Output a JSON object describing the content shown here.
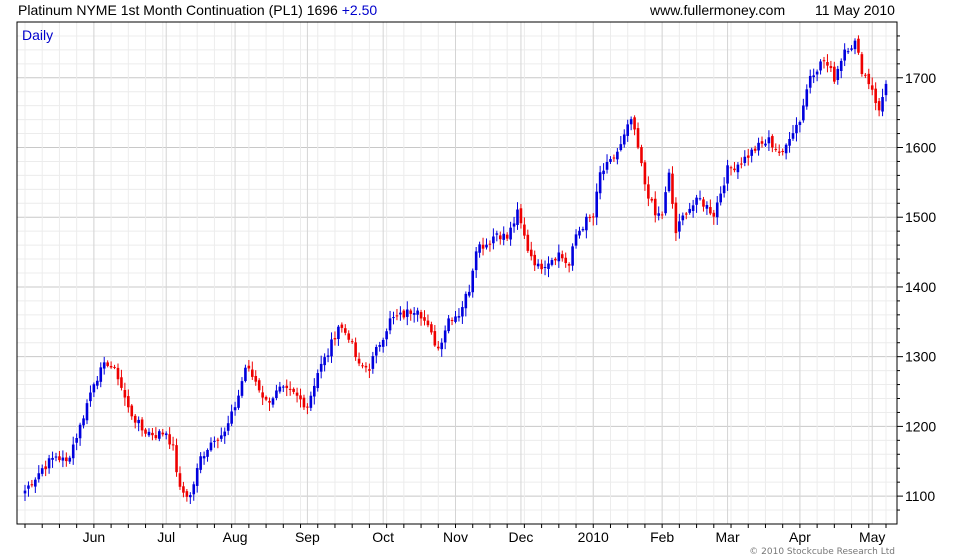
{
  "header": {
    "title": "Platinum NYME 1st Month Continuation (PL1)",
    "last_price": "1696",
    "change": "+2.50",
    "site": "www.fullermoney.com",
    "date": "11 May 2010"
  },
  "footer": {
    "copyright": "© 2010 Stockcube Research Ltd"
  },
  "colors": {
    "up": "#0000dd",
    "down": "#ee0000",
    "grid": "#dcdcdc",
    "frame": "#000000",
    "label_blue": "#0000cc"
  },
  "chart_data": {
    "type": "candlestick",
    "period_label": "Daily",
    "ylim": [
      1060,
      1780
    ],
    "y_ticks": [
      1100,
      1200,
      1300,
      1400,
      1500,
      1600,
      1700
    ],
    "x_ticks": [
      "Jun",
      "Jul",
      "Aug",
      "Sep",
      "Oct",
      "Nov",
      "Dec",
      "2010",
      "Feb",
      "Mar",
      "Apr",
      "May"
    ],
    "x_tick_index": [
      20,
      41,
      61,
      82,
      104,
      125,
      144,
      165,
      185,
      204,
      225,
      246
    ],
    "grid": true,
    "close_points": [
      [
        0,
        1108
      ],
      [
        5,
        1140
      ],
      [
        9,
        1158
      ],
      [
        12,
        1148
      ],
      [
        16,
        1200
      ],
      [
        20,
        1265
      ],
      [
        24,
        1292
      ],
      [
        27,
        1272
      ],
      [
        30,
        1225
      ],
      [
        34,
        1195
      ],
      [
        38,
        1188
      ],
      [
        41,
        1192
      ],
      [
        43,
        1168
      ],
      [
        45,
        1108
      ],
      [
        48,
        1100
      ],
      [
        51,
        1155
      ],
      [
        55,
        1185
      ],
      [
        58,
        1190
      ],
      [
        60,
        1215
      ],
      [
        62,
        1245
      ],
      [
        64,
        1285
      ],
      [
        67,
        1265
      ],
      [
        70,
        1235
      ],
      [
        74,
        1252
      ],
      [
        78,
        1246
      ],
      [
        82,
        1230
      ],
      [
        85,
        1278
      ],
      [
        88,
        1305
      ],
      [
        91,
        1345
      ],
      [
        94,
        1330
      ],
      [
        97,
        1285
      ],
      [
        100,
        1285
      ],
      [
        103,
        1320
      ],
      [
        106,
        1352
      ],
      [
        110,
        1360
      ],
      [
        114,
        1372
      ],
      [
        118,
        1330
      ],
      [
        120,
        1312
      ],
      [
        123,
        1355
      ],
      [
        126,
        1362
      ],
      [
        129,
        1398
      ],
      [
        131,
        1458
      ],
      [
        134,
        1462
      ],
      [
        137,
        1478
      ],
      [
        140,
        1470
      ],
      [
        143,
        1505
      ],
      [
        146,
        1455
      ],
      [
        149,
        1428
      ],
      [
        152,
        1438
      ],
      [
        155,
        1448
      ],
      [
        158,
        1430
      ],
      [
        160,
        1475
      ],
      [
        163,
        1495
      ],
      [
        165,
        1500
      ],
      [
        167,
        1562
      ],
      [
        170,
        1578
      ],
      [
        173,
        1602
      ],
      [
        176,
        1640
      ],
      [
        178,
        1598
      ],
      [
        180,
        1548
      ],
      [
        183,
        1502
      ],
      [
        185,
        1505
      ],
      [
        187,
        1560
      ],
      [
        189,
        1478
      ],
      [
        192,
        1510
      ],
      [
        196,
        1525
      ],
      [
        200,
        1505
      ],
      [
        204,
        1568
      ],
      [
        208,
        1580
      ],
      [
        212,
        1598
      ],
      [
        216,
        1610
      ],
      [
        220,
        1588
      ],
      [
        222,
        1618
      ],
      [
        225,
        1640
      ],
      [
        228,
        1705
      ],
      [
        232,
        1725
      ],
      [
        235,
        1700
      ],
      [
        238,
        1742
      ],
      [
        241,
        1750
      ],
      [
        243,
        1712
      ],
      [
        246,
        1685
      ],
      [
        248,
        1650
      ],
      [
        250,
        1695
      ]
    ]
  }
}
